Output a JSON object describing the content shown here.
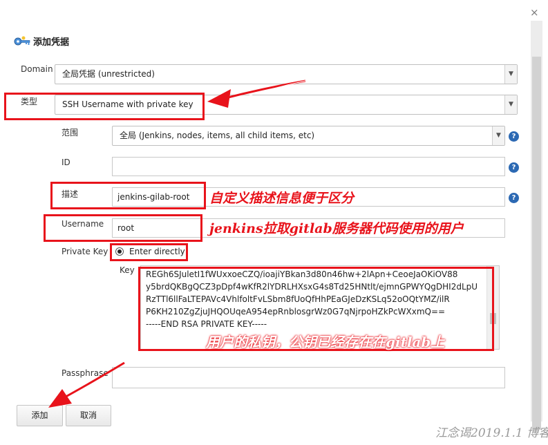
{
  "dialog": {
    "title": "添加凭据",
    "close_glyph": "×"
  },
  "fields": {
    "domain": {
      "label": "Domain",
      "value": "全局凭据 (unrestricted)"
    },
    "type": {
      "label": "类型",
      "value": "SSH Username with private key"
    },
    "scope": {
      "label": "范围",
      "value": "全局 (Jenkins, nodes, items, all child items, etc)"
    },
    "id": {
      "label": "ID",
      "value": ""
    },
    "description": {
      "label": "描述",
      "value": "jenkins-gilab-root"
    },
    "username": {
      "label": "Username",
      "value": "root"
    },
    "private_key": {
      "label": "Private Key",
      "option": "Enter directly",
      "key_label": "Key",
      "lines": [
        "REGh6SJuletI1fWUxxoeCZQ/ioajiYBkan3d80n46hw+2lApn+CeoeJaOKiOV88",
        "y5brdQKBgQCZ3pDpf4wKfR2lYDRLHXsxG4s8Td25HNtlt/ejmnGPWYQgDHI2dLpU",
        "RzTTl6llFaLTEPAVc4VhlfoltFvLSbm8fUoQfHhPEaGJeDzKSLq52oOQtYMZ/ilR",
        "P6KH210ZgZjuJHQOUqeA954epRnblosgrWz0G7qNjrpoHZkPcWXxmQ==",
        "-----END RSA PRIVATE KEY-----"
      ]
    },
    "passphrase": {
      "label": "Passphrase",
      "value": ""
    }
  },
  "buttons": {
    "add": "添加",
    "cancel": "取消"
  },
  "help_glyph": "?",
  "annotations": {
    "description_note": "自定义描述信息便于区分",
    "username_note": "jenkins拉取gitlab服务器代码使用的用户",
    "key_note": "用户的私钥，公钥已经存在在gitlab上"
  },
  "watermark": "江念谒2019.1.1 博客",
  "colors": {
    "annotation_red": "#e8131b",
    "help_blue": "#2c69b3"
  },
  "icons": [
    "key-icon",
    "chevron-down-icon",
    "help-icon",
    "close-icon",
    "arrow-icon"
  ]
}
